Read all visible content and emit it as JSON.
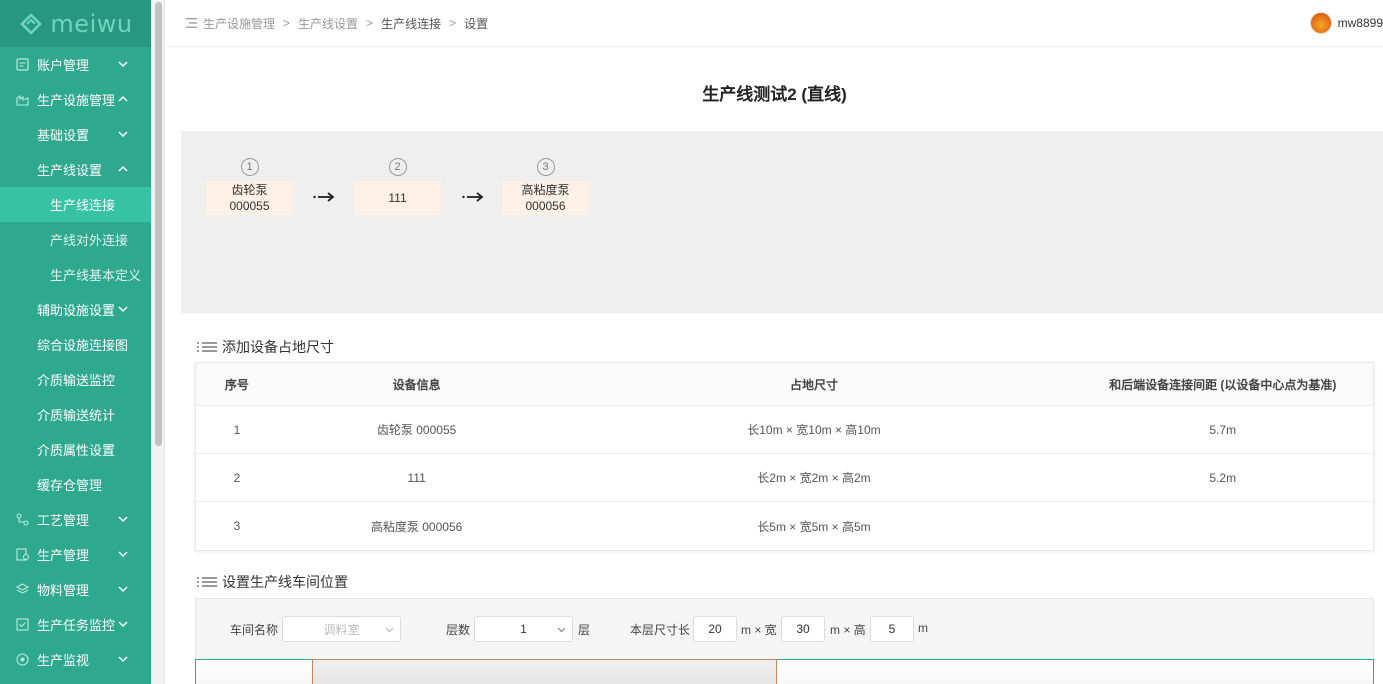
{
  "brand": {
    "logo_text": "meiwu",
    "accent": "#2ea98e",
    "active": "#35c3a4"
  },
  "sidebar": {
    "items": [
      {
        "label": "账户管理",
        "level": 1,
        "icon": "account-icon",
        "arrow": "down"
      },
      {
        "label": "生产设施管理",
        "level": 1,
        "icon": "factory-icon",
        "arrow": "up"
      },
      {
        "label": "基础设置",
        "level": 2,
        "arrow": "down"
      },
      {
        "label": "生产线设置",
        "level": 2,
        "arrow": "up"
      },
      {
        "label": "生产线连接",
        "level": 3,
        "active": true
      },
      {
        "label": "产线对外连接",
        "level": 3
      },
      {
        "label": "生产线基本定义",
        "level": 3
      },
      {
        "label": "辅助设施设置",
        "level": 2,
        "arrow": "down"
      },
      {
        "label": "综合设施连接图",
        "level": 2
      },
      {
        "label": "介质输送监控",
        "level": 2
      },
      {
        "label": "介质输送统计",
        "level": 2
      },
      {
        "label": "介质属性设置",
        "level": 2
      },
      {
        "label": "缓存仓管理",
        "level": 2
      },
      {
        "label": "工艺管理",
        "level": 1,
        "icon": "process-icon",
        "arrow": "down"
      },
      {
        "label": "生产管理",
        "level": 1,
        "icon": "production-icon",
        "arrow": "down"
      },
      {
        "label": "物料管理",
        "level": 1,
        "icon": "material-icon",
        "arrow": "down"
      },
      {
        "label": "生产任务监控",
        "level": 1,
        "icon": "task-icon",
        "arrow": "down"
      },
      {
        "label": "生产监视",
        "level": 1,
        "icon": "monitor-icon",
        "arrow": "down"
      }
    ]
  },
  "breadcrumb": {
    "items": [
      "生产设施管理",
      "生产线设置",
      "生产线连接",
      "设置"
    ],
    "separator": ">"
  },
  "user": {
    "name": "mw8899"
  },
  "page_title": "生产线测试2 (直线)",
  "flow": {
    "steps": [
      {
        "num": "1",
        "line1": "齿轮泵",
        "line2": "000055"
      },
      {
        "num": "2",
        "line1": "111",
        "line2": ""
      },
      {
        "num": "3",
        "line1": "高粘度泵",
        "line2": "000056"
      }
    ]
  },
  "section1": {
    "title": "添加设备占地尺寸"
  },
  "table": {
    "headers": [
      "序号",
      "设备信息",
      "占地尺寸",
      "和后端设备连接间距 (以设备中心点为基准)"
    ],
    "rows": [
      [
        "1",
        "齿轮泵 000055",
        "长10m × 宽10m × 高10m",
        "5.7m"
      ],
      [
        "2",
        "111",
        "长2m × 宽2m × 高2m",
        "5.2m"
      ],
      [
        "3",
        "高粘度泵 000056",
        "长5m × 宽5m × 高5m",
        ""
      ]
    ]
  },
  "section2": {
    "title": "设置生产线车间位置"
  },
  "form": {
    "workshop_label": "车间名称",
    "workshop_placeholder": "调料室",
    "floor_label": "层数",
    "floor_value": "1",
    "floor_unit": "层",
    "size_label": "本层尺寸长",
    "length": "20",
    "m_width": "m × 宽",
    "width": "30",
    "m_height": "m × 高",
    "height": "5",
    "m_end": "m"
  }
}
